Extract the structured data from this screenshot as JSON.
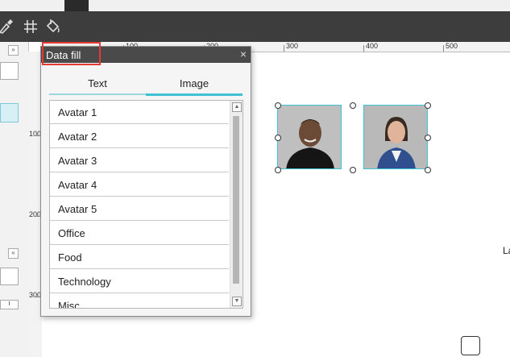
{
  "toolbar": {
    "icons": [
      "brush-icon",
      "grid-icon",
      "paint-bucket-icon"
    ]
  },
  "ruler": {
    "top_labels": [
      "100",
      "200",
      "300",
      "400",
      "500"
    ],
    "left_labels": [
      "100",
      "200",
      "300"
    ]
  },
  "left_panel": {
    "collapse_glyph": "»",
    "expand_glyph": "«",
    "field_text": "I"
  },
  "dialog": {
    "title": "Data fill",
    "close_glyph": "×",
    "tabs": [
      {
        "label": "Text"
      },
      {
        "label": "Image"
      }
    ],
    "active_tab": "Image",
    "items": [
      {
        "label": "Avatar 1"
      },
      {
        "label": "Avatar 2"
      },
      {
        "label": "Avatar 3"
      },
      {
        "label": "Avatar 4"
      },
      {
        "label": "Avatar 5"
      },
      {
        "label": "Office"
      },
      {
        "label": "Food"
      },
      {
        "label": "Technology"
      },
      {
        "label": "Misc"
      }
    ],
    "scroll_up_glyph": "▲",
    "scroll_down_glyph": "▼"
  },
  "canvas": {
    "right_label": "La",
    "photos": [
      {
        "name": "man-portrait"
      },
      {
        "name": "woman-portrait"
      }
    ]
  },
  "colors": {
    "accent": "#3ec1d3",
    "highlight": "#e53935",
    "toolbar": "#3d3d3d",
    "dialog_title": "#4a4a4a"
  }
}
